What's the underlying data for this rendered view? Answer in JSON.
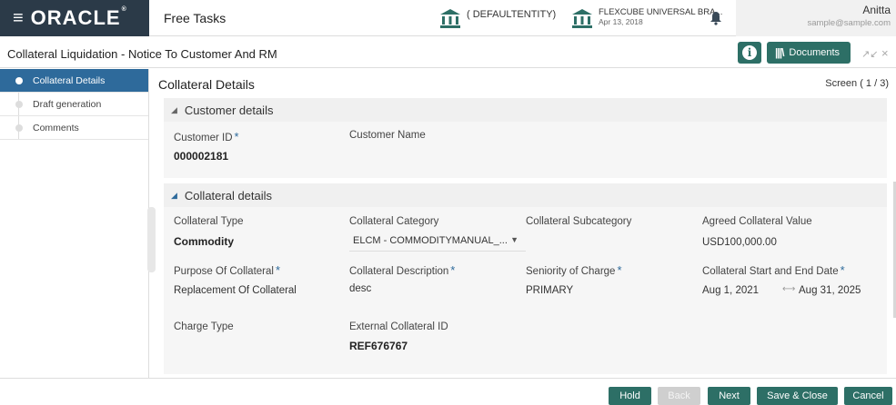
{
  "header": {
    "brand": "ORACLE",
    "app_title": "Free Tasks",
    "entity": "( DEFAULTENTITY)",
    "branch_name": "FLEXCUBE UNIVERSAL BRA...",
    "branch_date": "Apr 13, 2018",
    "user_name": "Anitta",
    "user_email": "sample@sample.com"
  },
  "titlebar": {
    "title": "Collateral Liquidation - Notice To Customer And RM",
    "documents_label": "Documents"
  },
  "sidebar": {
    "items": [
      {
        "label": "Collateral Details"
      },
      {
        "label": "Draft generation"
      },
      {
        "label": "Comments"
      }
    ]
  },
  "main": {
    "title": "Collateral Details",
    "screen_indicator": "Screen ( 1 / 3)",
    "customer_section": {
      "title": "Customer details",
      "customer_id_label": "Customer ID",
      "customer_id_value": "000002181",
      "customer_name_label": "Customer Name"
    },
    "collateral_section": {
      "title": "Collateral details",
      "type_label": "Collateral Type",
      "type_value": "Commodity",
      "category_label": "Collateral Category",
      "category_value": "ELCM - COMMODITYMANUAL_...",
      "subcategory_label": "Collateral Subcategory",
      "agreed_value_label": "Agreed Collateral Value",
      "agreed_value": "USD100,000.00",
      "purpose_label": "Purpose Of Collateral",
      "purpose_value": "Replacement Of Collateral",
      "description_label": "Collateral Description",
      "description_value": "desc",
      "seniority_label": "Seniority of Charge",
      "seniority_value": "PRIMARY",
      "dates_label": "Collateral Start and End Date",
      "start_date": "Aug 1, 2021",
      "end_date": "Aug 31, 2025",
      "charge_type_label": "Charge Type",
      "external_id_label": "External Collateral ID",
      "external_id_value": "REF676767"
    }
  },
  "footer": {
    "hold": "Hold",
    "back": "Back",
    "next": "Next",
    "save_close": "Save & Close",
    "cancel": "Cancel"
  },
  "colors": {
    "brand_dark": "#2b3a48",
    "active_step": "#2e6a9b",
    "primary_button": "#2d6f66",
    "disabled_button": "#cfcfcf"
  }
}
